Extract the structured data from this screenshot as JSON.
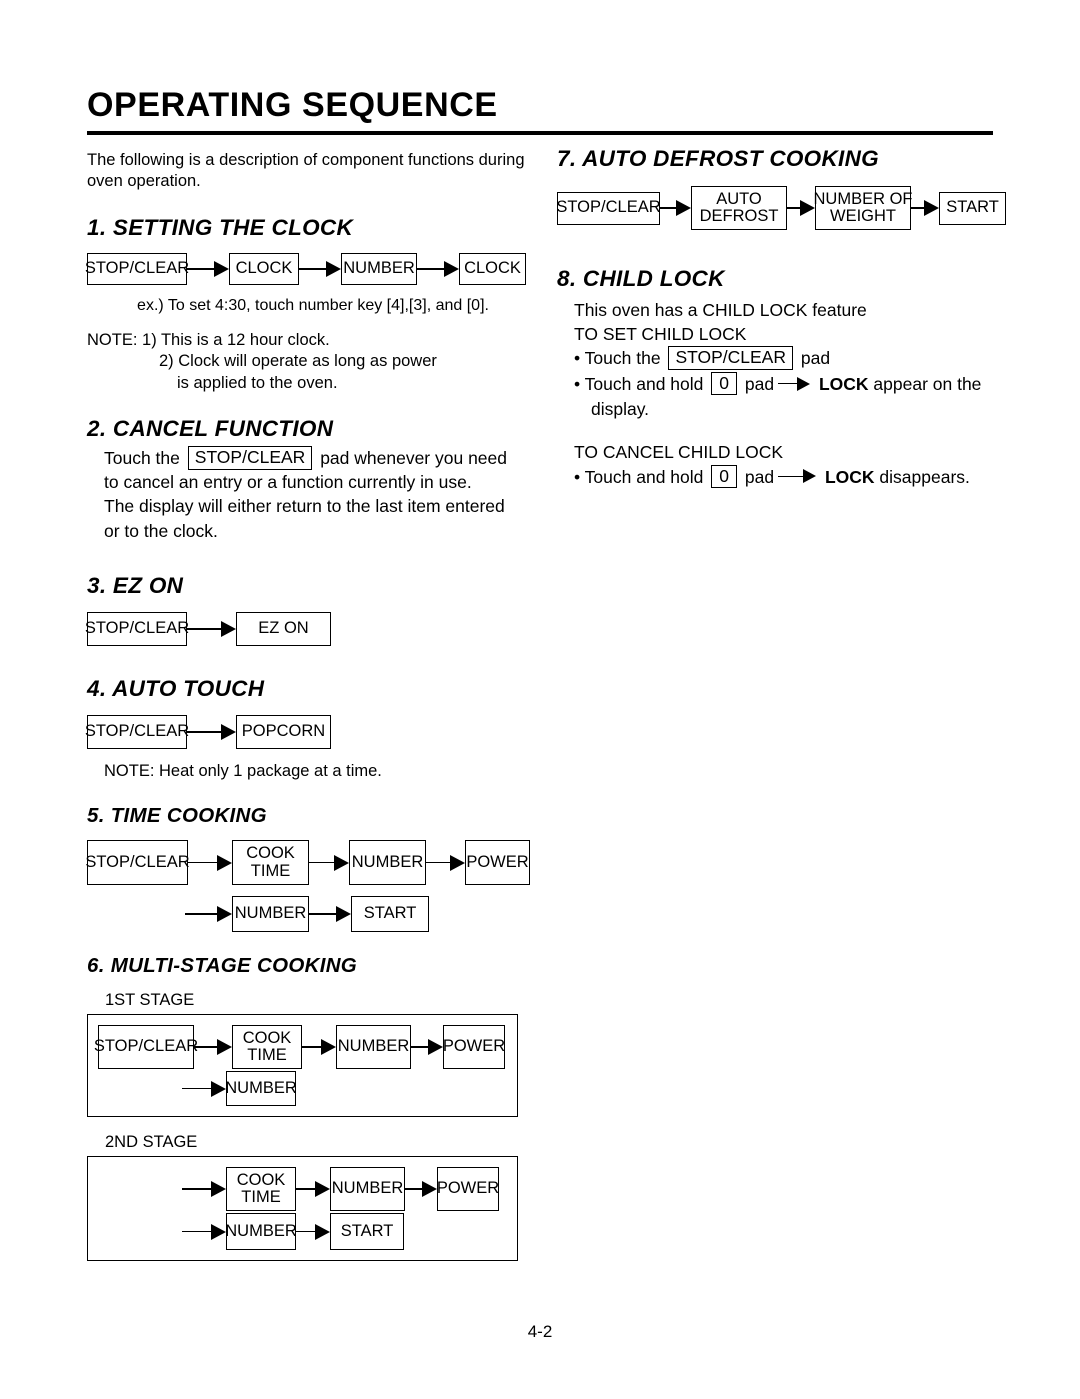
{
  "document": {
    "title": "OPERATING SEQUENCE",
    "page_number": "4-2"
  },
  "intro": {
    "text": "The following is a description of component functions during oven operation."
  },
  "sections": {
    "setting_clock": {
      "heading": "1. SETTING THE CLOCK",
      "flow": [
        "STOP/CLEAR",
        "CLOCK",
        "NUMBER",
        "CLOCK"
      ],
      "example": "ex.) To set 4:30, touch number key [4],[3], and [0].",
      "note_label": "NOTE:",
      "note_1": "1) This is a 12 hour clock.",
      "note_2": "2) Clock will operate as long as power",
      "note_2b": "is applied to the oven."
    },
    "cancel_function": {
      "heading": "2. CANCEL FUNCTION",
      "text_before_pad": "Touch the",
      "pad_label": "STOP/CLEAR",
      "text_after_pad": "pad whenever you need",
      "line_2": "to cancel an entry or a function currently in use.",
      "line_3": "The display will either return to the last item entered",
      "line_4": "or to the clock."
    },
    "ez_on": {
      "heading": "3. EZ ON",
      "flow": [
        "STOP/CLEAR",
        "EZ ON"
      ]
    },
    "auto_touch": {
      "heading": "4. AUTO TOUCH",
      "flow": [
        "STOP/CLEAR",
        "POPCORN"
      ],
      "note": "NOTE: Heat only 1 package at a time."
    },
    "time_cooking": {
      "heading": "5. TIME COOKING",
      "row1": [
        "STOP/CLEAR",
        "COOK",
        "TIME",
        "NUMBER",
        "POWER"
      ],
      "row1_box1": "STOP/CLEAR",
      "row1_box2_l1": "COOK",
      "row1_box2_l2": "TIME",
      "row1_box3": "NUMBER",
      "row1_box4": "POWER",
      "row2_box1": "NUMBER",
      "row2_box2": "START"
    },
    "multi_stage": {
      "heading": "6. MULTI-STAGE COOKING",
      "stage1": {
        "label": "1ST STAGE",
        "row1_box1": "STOP/CLEAR",
        "row1_box2_l1": "COOK",
        "row1_box2_l2": "TIME",
        "row1_box3": "NUMBER",
        "row1_box4": "POWER",
        "row2_box1": "NUMBER"
      },
      "stage2": {
        "label": "2ND STAGE",
        "row1_box1_l1": "COOK",
        "row1_box1_l2": "TIME",
        "row1_box2": "NUMBER",
        "row1_box3": "POWER",
        "row2_box1": "NUMBER",
        "row2_box2": "START"
      }
    },
    "auto_defrost": {
      "heading": "7. AUTO DEFROST COOKING",
      "box1": "STOP/CLEAR",
      "box2_l1": "AUTO",
      "box2_l2": "DEFROST",
      "box3_l1": "NUMBER OF",
      "box3_l2": "WEIGHT",
      "box4": "START"
    },
    "child_lock": {
      "heading": "8. CHILD LOCK",
      "intro": "This oven has a CHILD LOCK feature",
      "set_label": "TO SET CHILD LOCK",
      "set_b1_pre": "• Touch the",
      "set_b1_pad": "STOP/CLEAR",
      "set_b1_post": "pad",
      "set_b2_pre": "• Touch and hold",
      "set_b2_pad": "0",
      "set_b2_mid": "pad",
      "set_b2_lock": "LOCK",
      "set_b2_post": "appear on the",
      "set_b2_cont": "display.",
      "cancel_label": "TO CANCEL CHILD LOCK",
      "cancel_b1_pre": "• Touch and hold",
      "cancel_b1_pad": "0",
      "cancel_b1_mid": "pad",
      "cancel_b1_lock": "LOCK",
      "cancel_b1_post": "disappears."
    }
  }
}
